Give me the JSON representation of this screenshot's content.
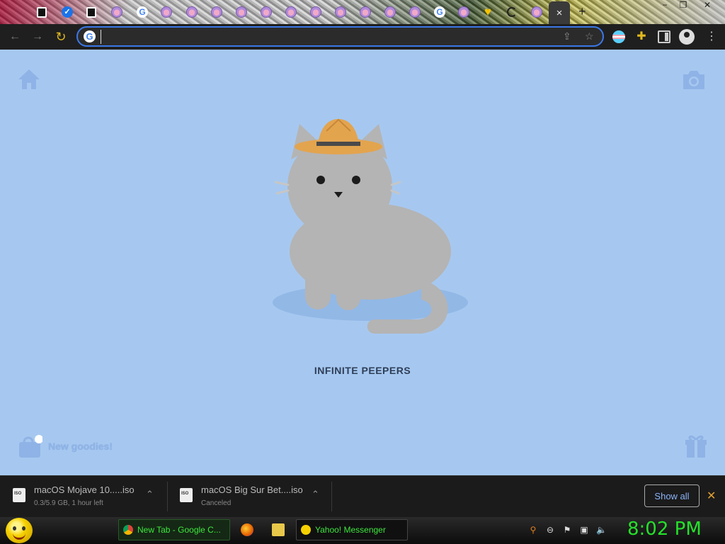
{
  "browser": {
    "active_tab_close": "×",
    "new_tab": "+",
    "window_controls": {
      "minimize": "−",
      "restore": "❐",
      "close": "✕"
    },
    "omnibox": {
      "value": "",
      "placeholder": ""
    }
  },
  "page": {
    "title": "INFINITE PEEPERS",
    "goodies_label": "New goodies!",
    "bg_color": "#a6c8f0"
  },
  "downloads": {
    "items": [
      {
        "name": "macOS Mojave 10.....iso",
        "status": "0.3/5.9 GB, 1 hour left"
      },
      {
        "name": "macOS Big Sur Bet....iso",
        "status": "Canceled"
      }
    ],
    "show_all": "Show all",
    "close": "✕"
  },
  "taskbar": {
    "tasks": [
      {
        "label": "New Tab - Google C..."
      },
      {
        "label": "Yahoo! Messenger"
      }
    ],
    "clock": "8:02 PM"
  }
}
